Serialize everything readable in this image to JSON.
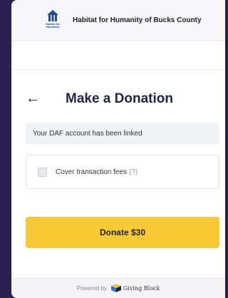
{
  "header": {
    "org_name": "Habitat for Humanity of Bucks County",
    "logo_text": "Habitat for Humanity"
  },
  "donation": {
    "title": "Make a Donation",
    "back_label": "←",
    "notice": "Your DAF account has been linked",
    "cover_fees_label": "Cover transaction fees",
    "cover_fees_help": "(?)",
    "cover_fees_checked": false,
    "donate_label": "Donate $30"
  },
  "footer": {
    "powered_by": "Powered by",
    "brand": "Giving Block"
  },
  "colors": {
    "background": "#2a1f4f",
    "accent": "#f7c934",
    "title": "#1f2346",
    "habitat_blue": "#1d4e89"
  },
  "icons": {
    "logo": "habitat-house-icon",
    "back": "arrow-left-icon",
    "brand": "giving-block-cube-icon"
  }
}
